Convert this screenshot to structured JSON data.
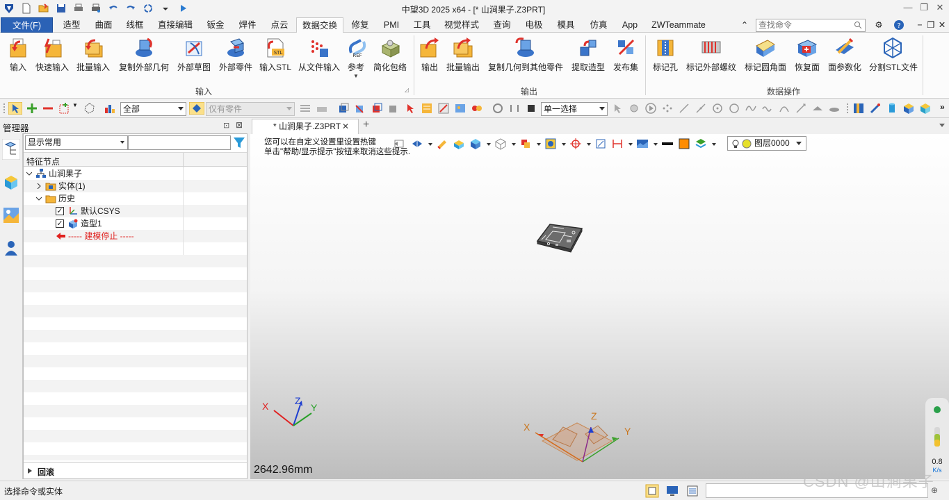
{
  "app": {
    "title": "中望3D 2025 x64 - [* 山涧果子.Z3PRT]"
  },
  "menu": {
    "tabs": [
      {
        "label": "文件(F)"
      },
      {
        "label": "造型"
      },
      {
        "label": "曲面"
      },
      {
        "label": "线框"
      },
      {
        "label": "直接编辑"
      },
      {
        "label": "钣金"
      },
      {
        "label": "焊件"
      },
      {
        "label": "点云"
      },
      {
        "label": "数据交换"
      },
      {
        "label": "修复"
      },
      {
        "label": "PMI"
      },
      {
        "label": "工具"
      },
      {
        "label": "视觉样式"
      },
      {
        "label": "查询"
      },
      {
        "label": "电极"
      },
      {
        "label": "模具"
      },
      {
        "label": "仿真"
      },
      {
        "label": "App"
      },
      {
        "label": "ZWTeammate"
      }
    ],
    "active_tab": "数据交换",
    "search_placeholder": "查找命令"
  },
  "ribbon": {
    "input_group": {
      "label": "输入",
      "buttons": [
        "输入",
        "快速输入",
        "批量输入",
        "复制外部几何",
        "外部草图",
        "外部零件",
        "输入STL",
        "从文件输入",
        "参考",
        "简化包络"
      ]
    },
    "output_group": {
      "label": "输出",
      "buttons": [
        "输出",
        "批量输出",
        "复制几何到其他零件",
        "提取造型",
        "发布集"
      ]
    },
    "data_group": {
      "label": "数据操作",
      "buttons": [
        "标记孔",
        "标记外部螺纹",
        "标记圆角面",
        "恢复面",
        "面参数化",
        "分割STL文件"
      ]
    }
  },
  "toolbar": {
    "filter_value": "全部",
    "parts_filter_value": "仅有零件",
    "selection_mode": "单一选择"
  },
  "manager": {
    "title": "管理器",
    "display_filter": "显示常用",
    "tree_header": "特征节点",
    "rows": [
      {
        "label": "山涧果子"
      },
      {
        "label": "实体(1)"
      },
      {
        "label": "历史"
      },
      {
        "label": "默认CSYS"
      },
      {
        "label": "造型1"
      },
      {
        "label": "----- 建模停止 -----"
      }
    ],
    "rollback_label": "回滚"
  },
  "document": {
    "tab_label": "* 山涧果子.Z3PRT",
    "hint_line1": "您可以在自定义设置里设置热键",
    "hint_line2": "单击\"帮助/显示提示\"按钮来取消这些提示.",
    "layer_name": "图层0000",
    "distance": "2642.96mm",
    "axis_x": "X",
    "axis_y": "Y",
    "axis_z": "Z",
    "perf_value": "0.8",
    "perf_unit": "K/s"
  },
  "status": {
    "text": "选择命令或实体"
  },
  "watermark": "CSDN @山涧果子",
  "colors": {
    "accent": "#2b62b6",
    "stop_marker": "#e0201e",
    "axis_x": "#e02020",
    "axis_y": "#2aa02a",
    "axis_z": "#1f3fd0"
  }
}
